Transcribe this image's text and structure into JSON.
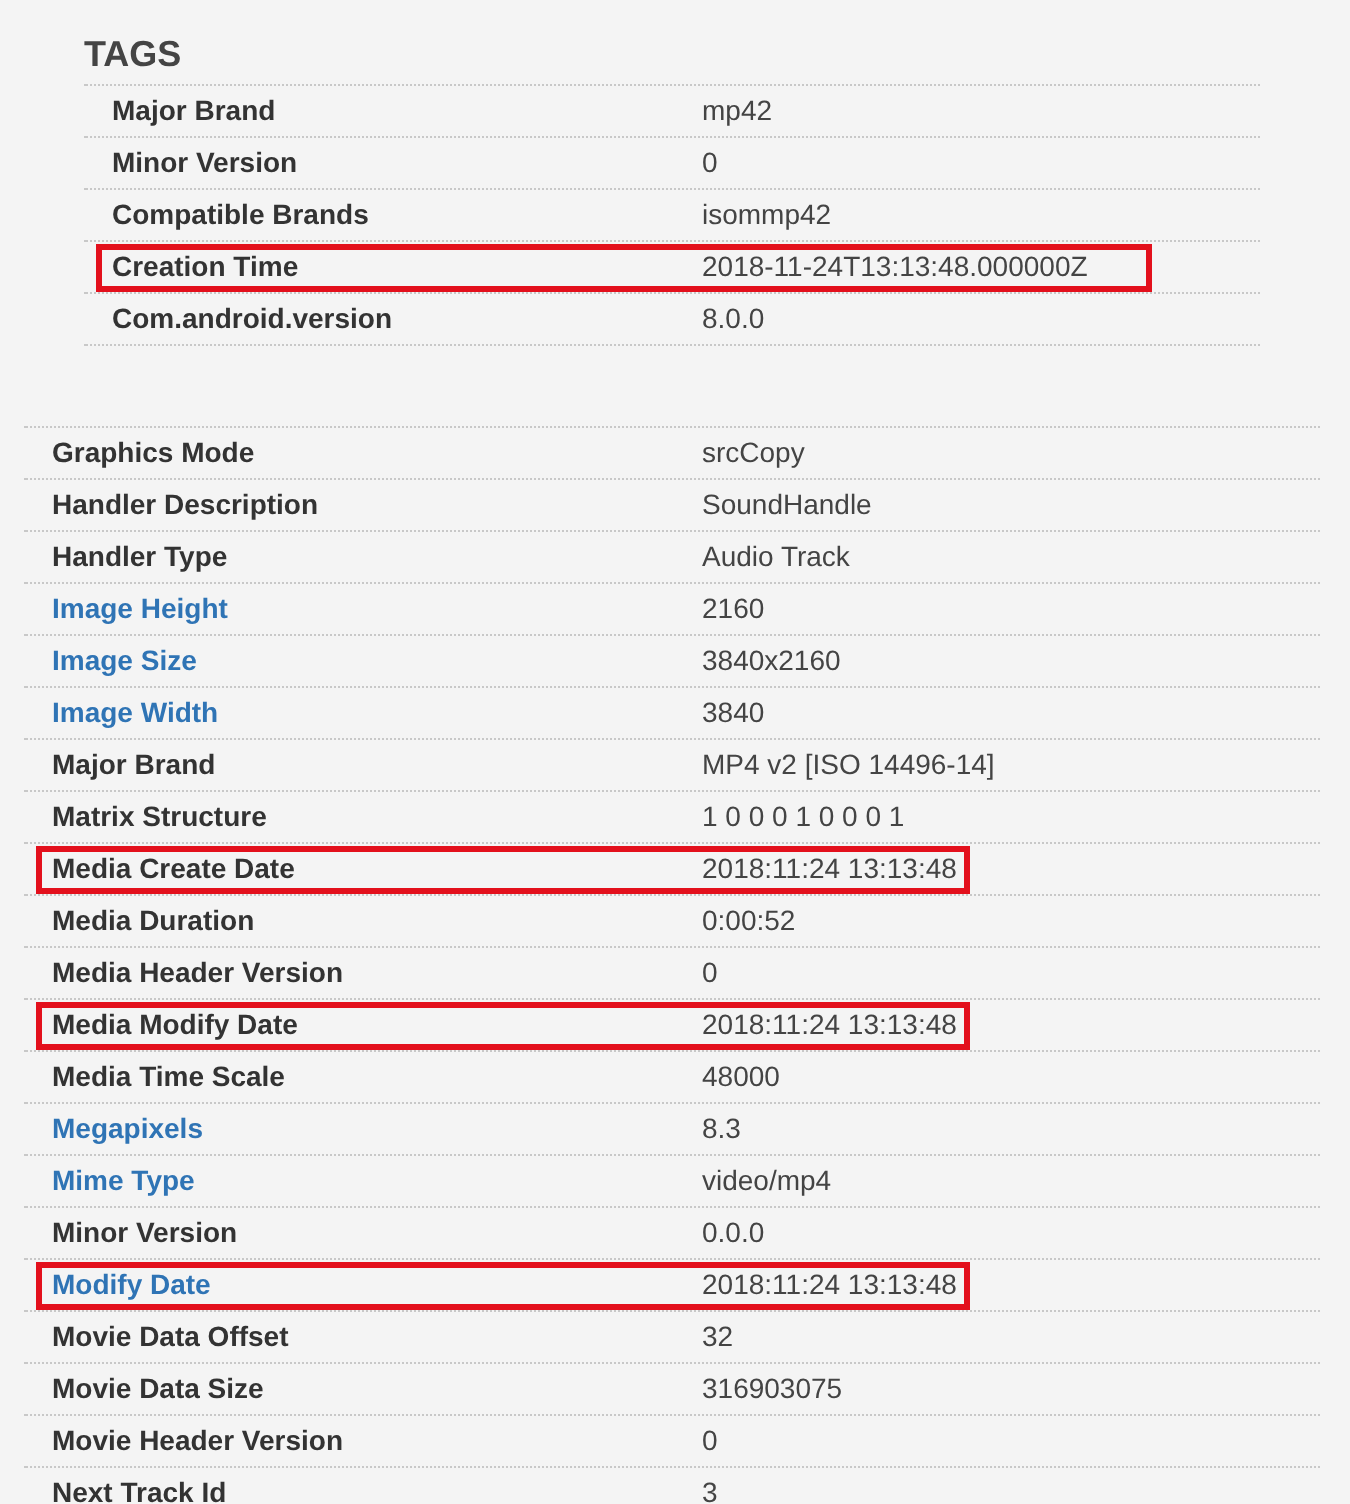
{
  "tags": {
    "title": "TAGS",
    "rows": [
      {
        "label": "Major Brand",
        "value": "mp42",
        "link": false,
        "highlighted": false
      },
      {
        "label": "Minor Version",
        "value": "0",
        "link": false,
        "highlighted": false
      },
      {
        "label": "Compatible Brands",
        "value": "isommp42",
        "link": false,
        "highlighted": false
      },
      {
        "label": "Creation Time",
        "value": "2018-11-24T13:13:48.000000Z",
        "link": false,
        "highlighted": true
      },
      {
        "label": "Com.android.version",
        "value": "8.0.0",
        "link": false,
        "highlighted": false
      }
    ]
  },
  "properties": {
    "rows": [
      {
        "label": "Graphics Mode",
        "value": "srcCopy",
        "link": false,
        "highlighted": false
      },
      {
        "label": "Handler Description",
        "value": "SoundHandle",
        "link": false,
        "highlighted": false
      },
      {
        "label": "Handler Type",
        "value": "Audio Track",
        "link": false,
        "highlighted": false
      },
      {
        "label": "Image Height",
        "value": "2160",
        "link": true,
        "highlighted": false
      },
      {
        "label": "Image Size",
        "value": "3840x2160",
        "link": true,
        "highlighted": false
      },
      {
        "label": "Image Width",
        "value": "3840",
        "link": true,
        "highlighted": false
      },
      {
        "label": "Major Brand",
        "value": "MP4 v2 [ISO 14496-14]",
        "link": false,
        "highlighted": false
      },
      {
        "label": "Matrix Structure",
        "value": "1 0 0 0 1 0 0 0 1",
        "link": false,
        "highlighted": false
      },
      {
        "label": "Media Create Date",
        "value": "2018:11:24 13:13:48",
        "link": false,
        "highlighted": true
      },
      {
        "label": "Media Duration",
        "value": "0:00:52",
        "link": false,
        "highlighted": false
      },
      {
        "label": "Media Header Version",
        "value": "0",
        "link": false,
        "highlighted": false
      },
      {
        "label": "Media Modify Date",
        "value": "2018:11:24 13:13:48",
        "link": false,
        "highlighted": true
      },
      {
        "label": "Media Time Scale",
        "value": "48000",
        "link": false,
        "highlighted": false
      },
      {
        "label": "Megapixels",
        "value": "8.3",
        "link": true,
        "highlighted": false
      },
      {
        "label": "Mime Type",
        "value": "video/mp4",
        "link": true,
        "highlighted": false
      },
      {
        "label": "Minor Version",
        "value": "0.0.0",
        "link": false,
        "highlighted": false
      },
      {
        "label": "Modify Date",
        "value": "2018:11:24 13:13:48",
        "link": true,
        "highlighted": true
      },
      {
        "label": "Movie Data Offset",
        "value": "32",
        "link": false,
        "highlighted": false
      },
      {
        "label": "Movie Data Size",
        "value": "316903075",
        "link": false,
        "highlighted": false
      },
      {
        "label": "Movie Header Version",
        "value": "0",
        "link": false,
        "highlighted": false
      },
      {
        "label": "Next Track Id",
        "value": "3",
        "link": false,
        "highlighted": false
      }
    ]
  }
}
